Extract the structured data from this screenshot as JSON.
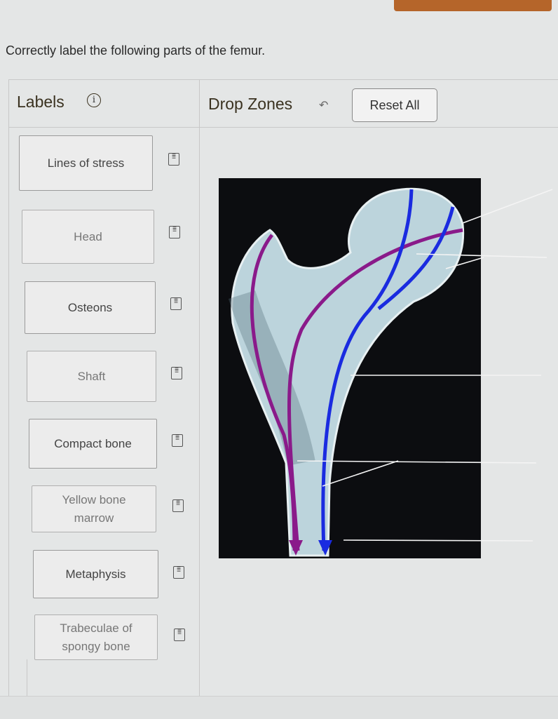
{
  "prompt": "Correctly label the following parts of the femur.",
  "labels_panel": {
    "title": "Labels",
    "info_icon": "info-icon"
  },
  "drop_zones": {
    "title": "Drop Zones",
    "undo_icon": "undo-arrow-icon",
    "reset_label": "Reset All"
  },
  "labels": [
    {
      "text": "Lines of stress"
    },
    {
      "text": "Head"
    },
    {
      "text": "Osteons"
    },
    {
      "text": "Shaft"
    },
    {
      "text": "Compact bone"
    },
    {
      "text": "Yellow bone marrow"
    },
    {
      "text": "Metaphysis"
    },
    {
      "text": "Trabeculae of spongy bone"
    }
  ],
  "colors": {
    "accent": "#b5652a",
    "stress_purple": "#8a1a8a",
    "stress_blue": "#1a2be0",
    "bone": "#bfd6de"
  }
}
